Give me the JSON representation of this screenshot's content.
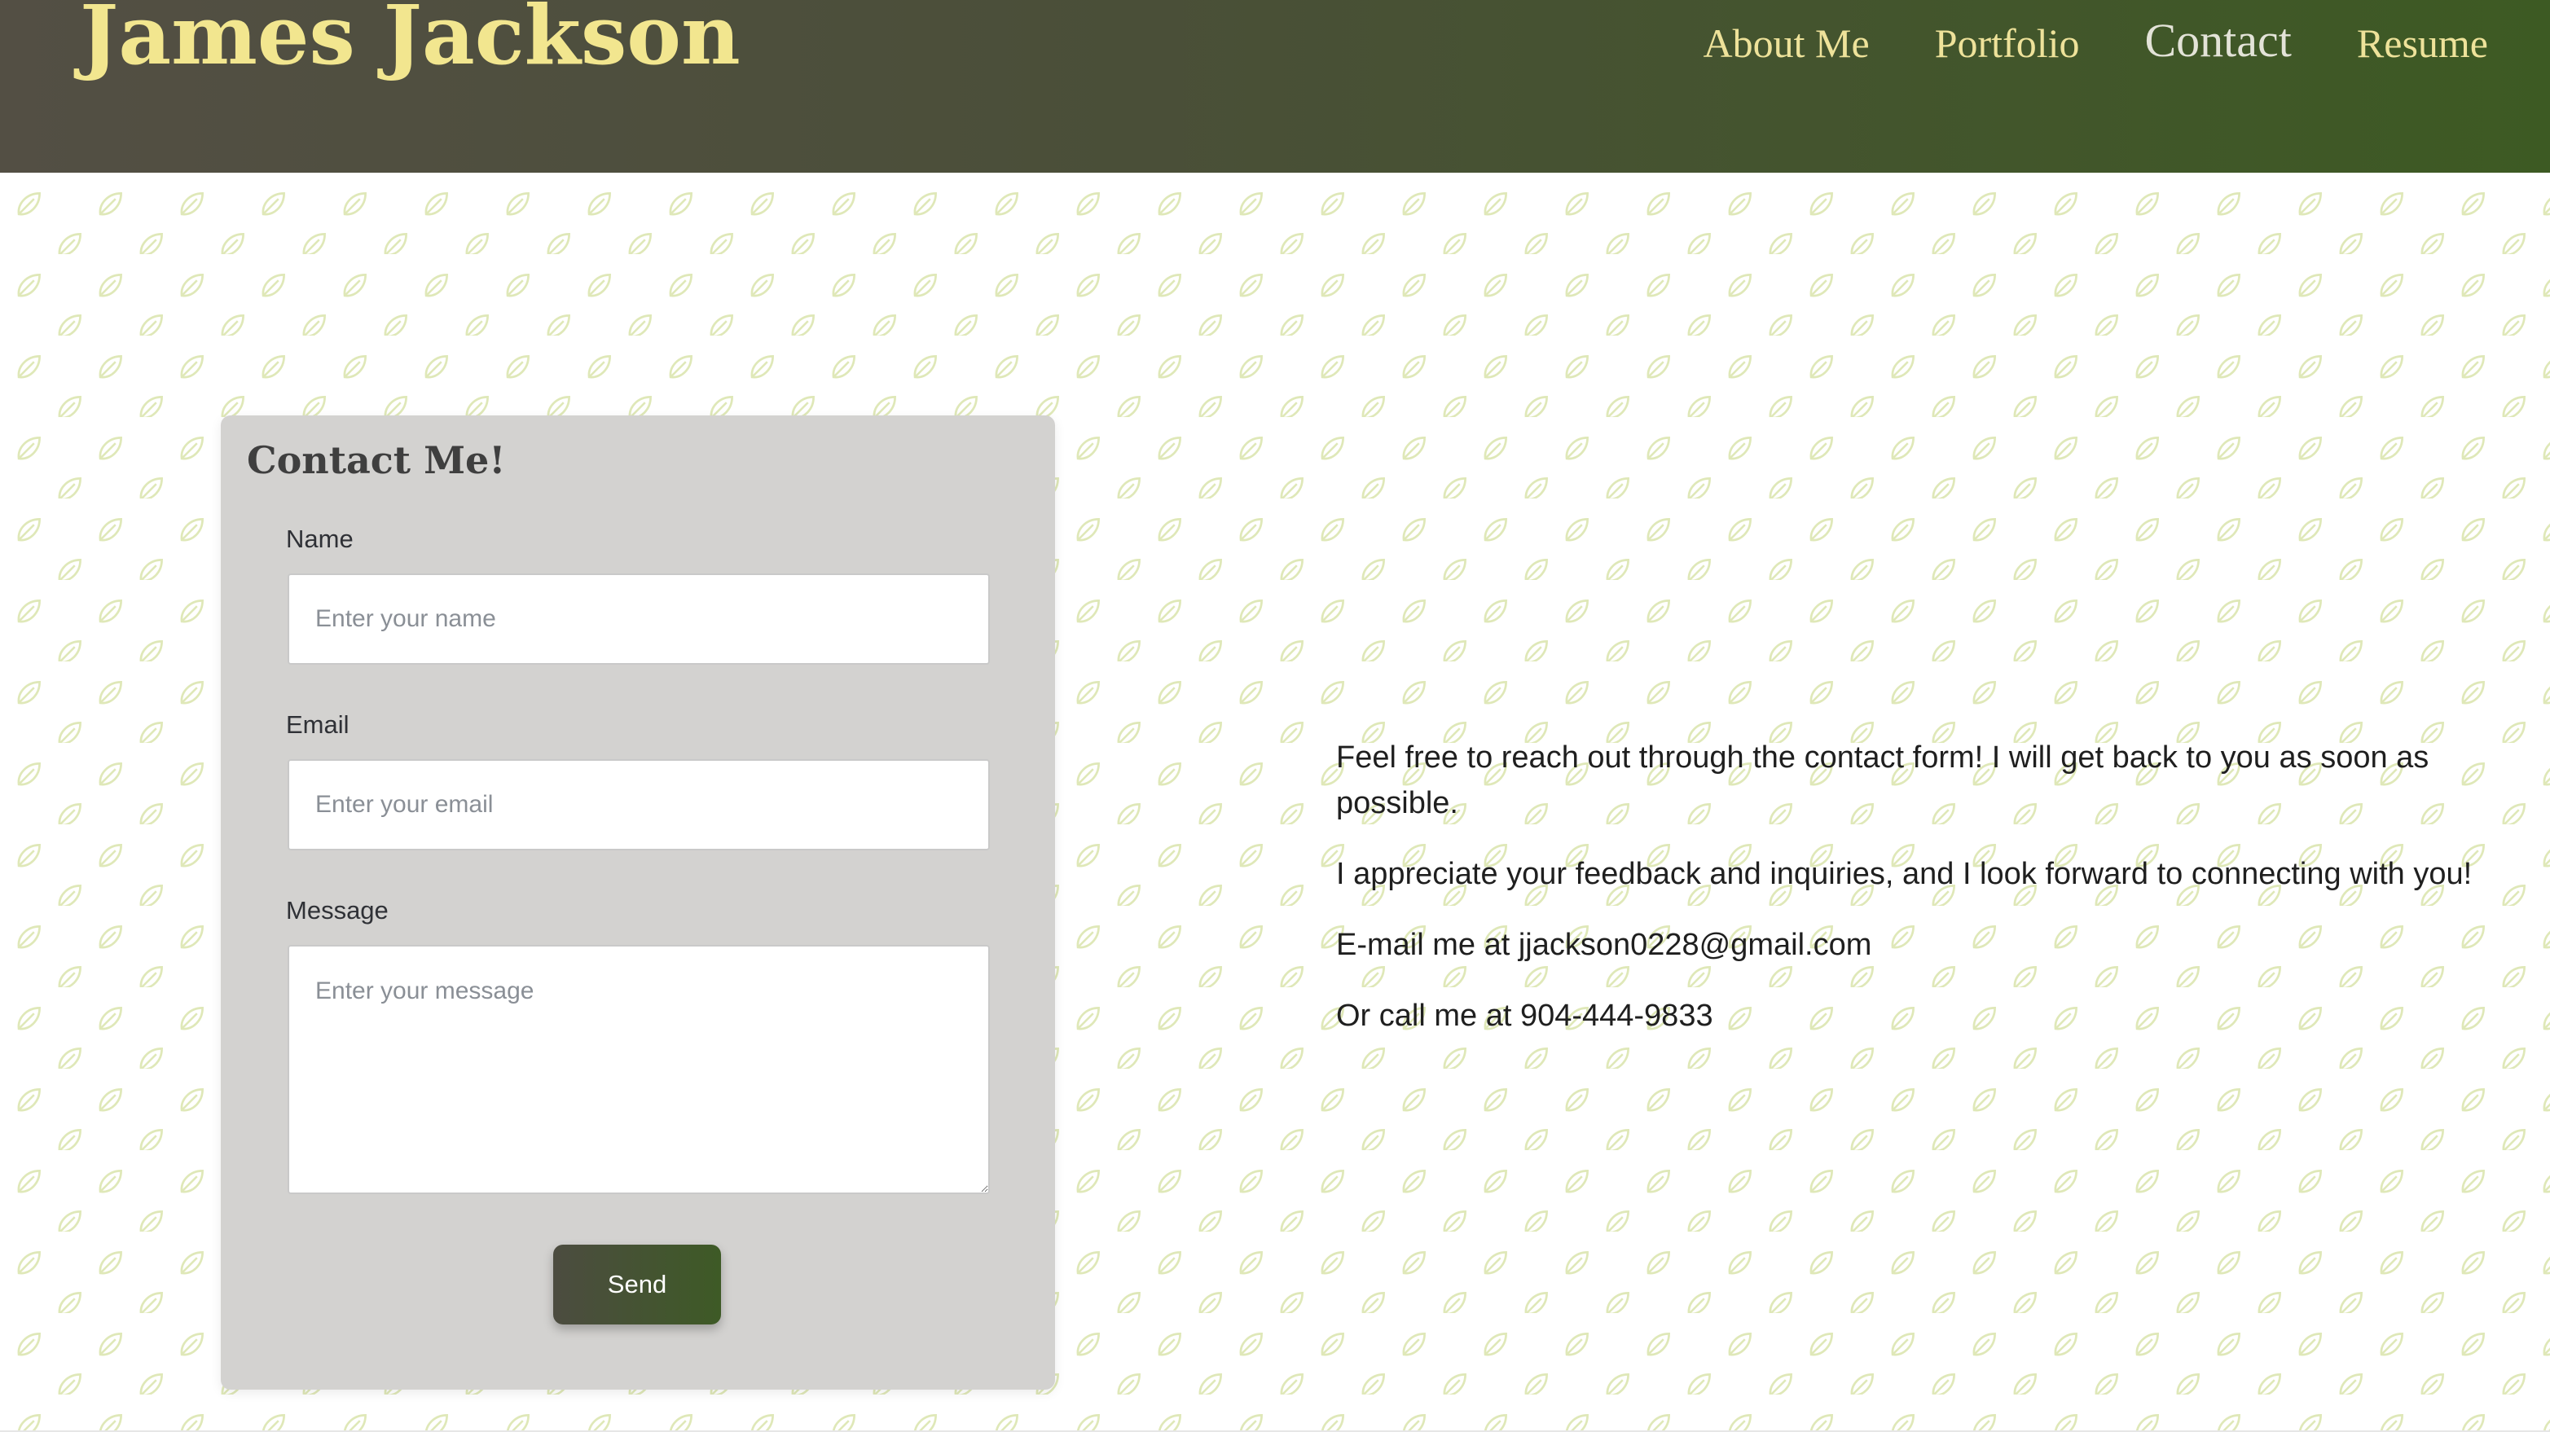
{
  "site": {
    "title": "James Jackson"
  },
  "nav": {
    "items": [
      {
        "label": "About Me",
        "active": false
      },
      {
        "label": "Portfolio",
        "active": false
      },
      {
        "label": "Contact",
        "active": true
      },
      {
        "label": "Resume",
        "active": false
      }
    ]
  },
  "contact_form": {
    "title": "Contact Me!",
    "name": {
      "label": "Name",
      "placeholder": "Enter your name",
      "value": ""
    },
    "email": {
      "label": "Email",
      "placeholder": "Enter your email",
      "value": ""
    },
    "message": {
      "label": "Message",
      "placeholder": "Enter your message",
      "value": ""
    },
    "submit_label": "Send"
  },
  "info": {
    "p1": "Feel free to reach out through the contact form! I will get back to you as soon as possible.",
    "p2": "I appreciate your feedback and inquiries, and I look forward to connecting with you!",
    "p3": "E-mail me at jjackson0228@gmail.com",
    "p4": "Or call me at 904-444-9833"
  },
  "colors": {
    "header_gradient_start": "#534f44",
    "header_gradient_end": "#3d5a23",
    "title_yellow": "#f2e68f",
    "card_gray": "#d3d2d0",
    "leaf_pattern": "#dfe8b8"
  }
}
